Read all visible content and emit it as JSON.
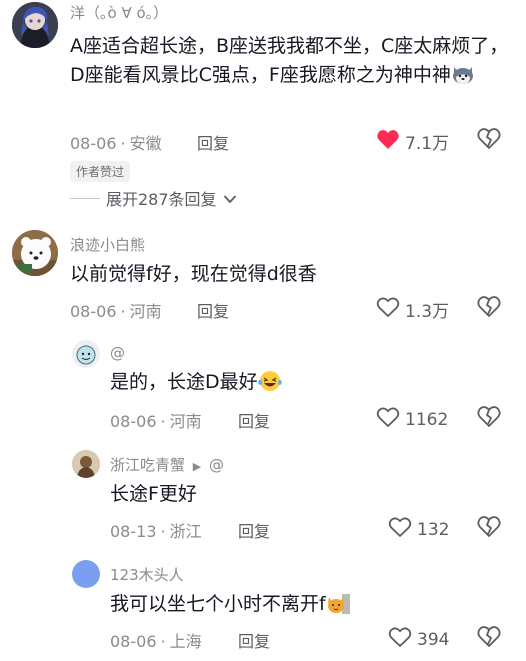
{
  "comments": [
    {
      "username": "洋（｡ò ∀ ó｡）",
      "text": "A座适合超长途，B座送我我都不坐，C座太麻烦了，D座能看风景比C强点，F座我愿称之为神中神",
      "date": "08-06",
      "location": "安徽",
      "reply_label": "回复",
      "likes": "7.1万",
      "liked": true,
      "author_tag": "作者赞过",
      "expand_label": "展开287条回复"
    },
    {
      "username": "浪迹小白熊",
      "text": "以前觉得f好，现在觉得d很香",
      "date": "08-06",
      "location": "河南",
      "reply_label": "回复",
      "likes": "1.3万"
    }
  ],
  "replies": [
    {
      "username": "@",
      "text": "是的，长途D最好",
      "date": "08-06",
      "location": "河南",
      "reply_label": "回复",
      "likes": "1162"
    },
    {
      "username": "浙江吃青蟹",
      "reply_to": "@",
      "text": "长途F更好",
      "date": "08-13",
      "location": "浙江",
      "reply_label": "回复",
      "likes": "132"
    },
    {
      "username": "123木头人",
      "text": "我可以坐七个小时不离开f",
      "date": "08-06",
      "location": "上海",
      "reply_label": "回复",
      "likes": "394"
    }
  ],
  "colors": {
    "liked_heart": "#fe2c55",
    "meta": "#8a8b91",
    "text": "#161823"
  }
}
